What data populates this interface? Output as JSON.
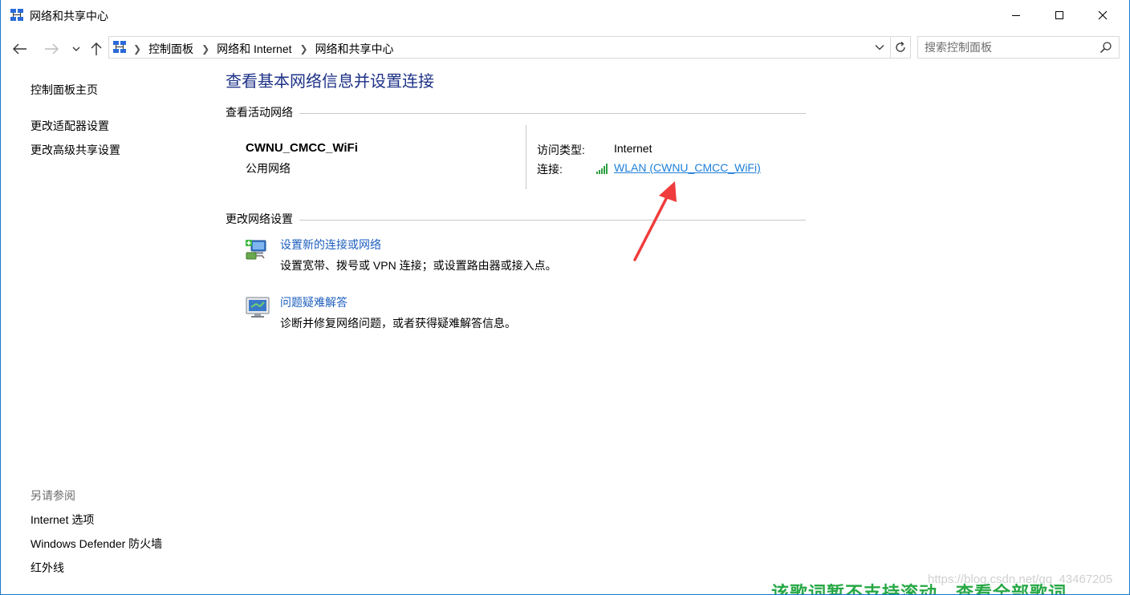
{
  "window": {
    "title": "网络和共享中心",
    "icon": "network-center-icon",
    "controls": {
      "minimize": "minimize-icon",
      "maximize": "maximize-icon",
      "close": "close-icon"
    }
  },
  "navbar": {
    "back": "arrow-left-icon",
    "forward": "arrow-right-icon",
    "recent": "chevron-down-icon",
    "up": "arrow-up-icon",
    "breadcrumbs": [
      "控制面板",
      "网络和 Internet",
      "网络和共享中心"
    ],
    "refresh": "refresh-icon",
    "search_placeholder": "搜索控制面板"
  },
  "sidebar": {
    "links": [
      "控制面板主页",
      "更改适配器设置",
      "更改高级共享设置"
    ],
    "see_also_heading": "另请参阅",
    "see_also": [
      "Internet 选项",
      "Windows Defender 防火墙",
      "红外线"
    ]
  },
  "main": {
    "title": "查看基本网络信息并设置连接",
    "active_section": "查看活动网络",
    "network": {
      "name": "CWNU_CMCC_WiFi",
      "category": "公用网络",
      "access_label": "访问类型:",
      "access_value": "Internet",
      "connection_label": "连接:",
      "connection_value": "WLAN (CWNU_CMCC_WiFi)"
    },
    "change_section": "更改网络设置",
    "tasks": [
      {
        "title": "设置新的连接或网络",
        "desc": "设置宽带、拨号或 VPN 连接；或设置路由器或接入点。",
        "icon": "new-connection-icon"
      },
      {
        "title": "问题疑难解答",
        "desc": "诊断并修复网络问题，或者获得疑难解答信息。",
        "icon": "troubleshoot-icon"
      }
    ]
  },
  "overlay": {
    "watermark": "https://blog.csdn.net/qq_43467205",
    "banner": "该歌词暂不支持滚动，查看全部歌词"
  },
  "colors": {
    "title_blue": "#1e3287",
    "link_blue": "#1e5fbf",
    "connection_link": "#1e7fd8",
    "annotation_red": "#f03c3c"
  }
}
